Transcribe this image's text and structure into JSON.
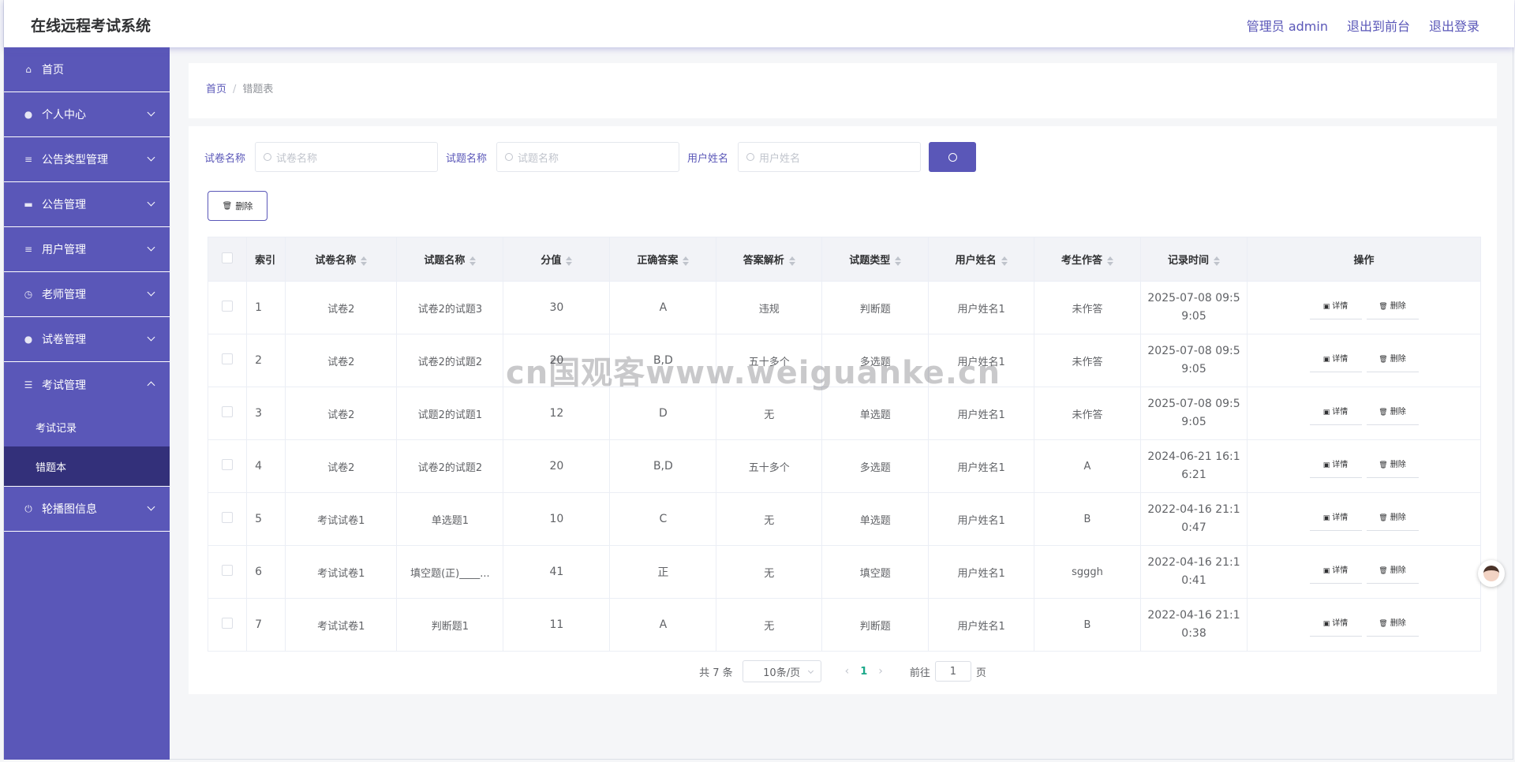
{
  "app": {
    "title": "在线远程考试系统"
  },
  "header": {
    "admin": "管理员 admin",
    "front": "退出到前台",
    "logout": "退出登录"
  },
  "sidebar": {
    "items": [
      {
        "label": "首页",
        "icon": "home-icon"
      },
      {
        "label": "个人中心",
        "icon": "user-icon"
      },
      {
        "label": "公告类型管理",
        "icon": "list-icon"
      },
      {
        "label": "公告管理",
        "icon": "monitor-icon"
      },
      {
        "label": "用户管理",
        "icon": "list-icon"
      },
      {
        "label": "老师管理",
        "icon": "clock-icon"
      },
      {
        "label": "试卷管理",
        "icon": "user-icon"
      },
      {
        "label": "考试管理",
        "icon": "sliders-icon"
      },
      {
        "label": "轮播图信息",
        "icon": "power-icon"
      }
    ],
    "sub": [
      {
        "label": "考试记录"
      },
      {
        "label": "错题本"
      }
    ]
  },
  "breadcrumb": {
    "home": "首页",
    "sep": "/",
    "current": "错题表"
  },
  "search": {
    "paper_label": "试卷名称",
    "paper_placeholder": "试卷名称",
    "question_label": "试题名称",
    "question_placeholder": "试题名称",
    "user_label": "用户姓名",
    "user_placeholder": "用户姓名"
  },
  "toolbar": {
    "delete_label": "删除"
  },
  "table": {
    "headers": [
      "索引",
      "试卷名称",
      "试题名称",
      "分值",
      "正确答案",
      "答案解析",
      "试题类型",
      "用户姓名",
      "考生作答",
      "记录时间",
      "操作"
    ],
    "rows": [
      {
        "idx": "1",
        "paper": "试卷2",
        "question": "试卷2的试题3",
        "score": "30",
        "answer": "A",
        "analysis": "违规",
        "type": "判断题",
        "user": "用户姓名1",
        "reply": "未作答",
        "time1": "2025-07-08 09:5",
        "time2": "9:05"
      },
      {
        "idx": "2",
        "paper": "试卷2",
        "question": "试卷2的试题2",
        "score": "20",
        "answer": "B,D",
        "analysis": "五十多个",
        "type": "多选题",
        "user": "用户姓名1",
        "reply": "未作答",
        "time1": "2025-07-08 09:5",
        "time2": "9:05"
      },
      {
        "idx": "3",
        "paper": "试卷2",
        "question": "试题2的试题1",
        "score": "12",
        "answer": "D",
        "analysis": "无",
        "type": "单选题",
        "user": "用户姓名1",
        "reply": "未作答",
        "time1": "2025-07-08 09:5",
        "time2": "9:05"
      },
      {
        "idx": "4",
        "paper": "试卷2",
        "question": "试卷2的试题2",
        "score": "20",
        "answer": "B,D",
        "analysis": "五十多个",
        "type": "多选题",
        "user": "用户姓名1",
        "reply": "A",
        "time1": "2024-06-21 16:1",
        "time2": "6:21"
      },
      {
        "idx": "5",
        "paper": "考试试卷1",
        "question": "单选题1",
        "score": "10",
        "answer": "C",
        "analysis": "无",
        "type": "单选题",
        "user": "用户姓名1",
        "reply": "B",
        "time1": "2022-04-16 21:1",
        "time2": "0:47"
      },
      {
        "idx": "6",
        "paper": "考试试卷1",
        "question": "填空题(正)____...",
        "score": "41",
        "answer": "正",
        "analysis": "无",
        "type": "填空题",
        "user": "用户姓名1",
        "reply": "sgggh",
        "time1": "2022-04-16 21:1",
        "time2": "0:41"
      },
      {
        "idx": "7",
        "paper": "考试试卷1",
        "question": "判断题1",
        "score": "11",
        "answer": "A",
        "analysis": "无",
        "type": "判断题",
        "user": "用户姓名1",
        "reply": "B",
        "time1": "2022-04-16 21:1",
        "time2": "0:38"
      }
    ],
    "op_detail": "详情",
    "op_delete": "删除"
  },
  "pager": {
    "total": "共 7 条",
    "size": "10条/页",
    "page": "1",
    "goto_label": "前往",
    "goto_value": "1",
    "goto_suffix": "页"
  },
  "watermark": "cn国观客www.weiguanke.cn",
  "colors": {
    "primary": "#5a57b8",
    "active_sub": "#33307a",
    "page_active": "#1aa889"
  }
}
